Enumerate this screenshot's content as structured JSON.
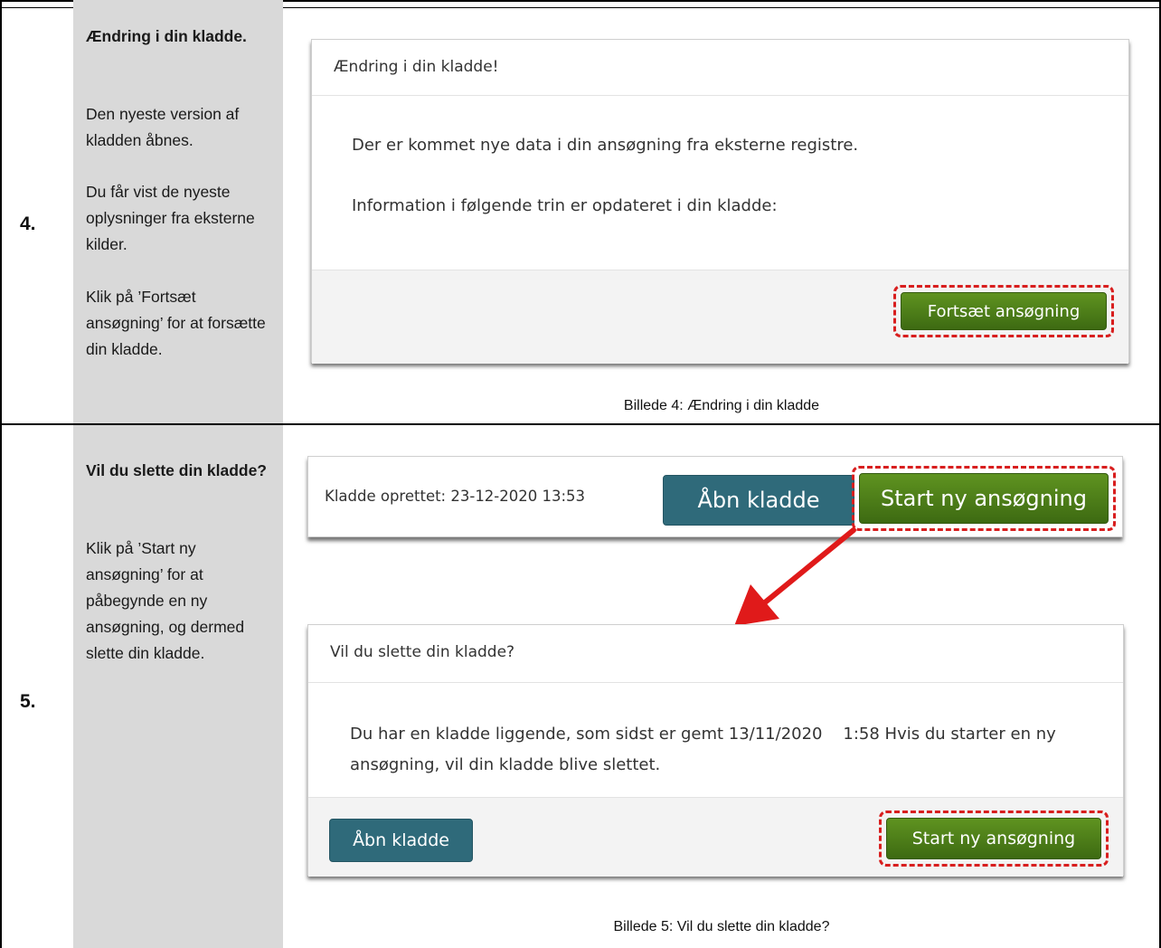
{
  "steps": [
    {
      "number": "4.",
      "title": "Ændring i din kladde.",
      "paragraphs": [
        "Den nyeste version af kladden åbnes.",
        "Du får vist de nyeste oplysninger fra eksterne kilder.",
        "Klik på ’Fortsæt ansøgning’ for at forsætte din kladde."
      ],
      "dialog": {
        "header": "Ændring i din kladde!",
        "line1": "Der er kommet nye data i din ansøgning fra eksterne registre.",
        "line2": "Information i følgende trin er opdateret i din kladde:",
        "button": "Fortsæt ansøgning"
      },
      "caption": "Billede 4: Ændring i din kladde"
    },
    {
      "number": "5.",
      "title": "Vil du slette din kladde?",
      "paragraphs": [
        "Klik på ’Start ny ansøgning’ for at påbegynde en ny ansøgning, og dermed slette din kladde."
      ],
      "bar": {
        "created": "Kladde oprettet: 23-12-2020 13:53",
        "open_button": "Åbn kladde",
        "start_button": "Start ny ansøgning"
      },
      "dialog": {
        "header": "Vil du slette din kladde?",
        "body": "Du har en kladde liggende, som sidst er gemt 13/11/2020    1:58 Hvis du starter en ny ansøgning, vil din kladde blive slettet.",
        "open_button": "Åbn kladde",
        "start_button": "Start ny ansøgning"
      },
      "caption": "Billede 5: Vil du slette din kladde?"
    }
  ],
  "colors": {
    "sidebar": "#d9d9d9",
    "green_button": "#4a7c17",
    "teal_button": "#2f6a7a",
    "highlight": "#d81e1e"
  }
}
